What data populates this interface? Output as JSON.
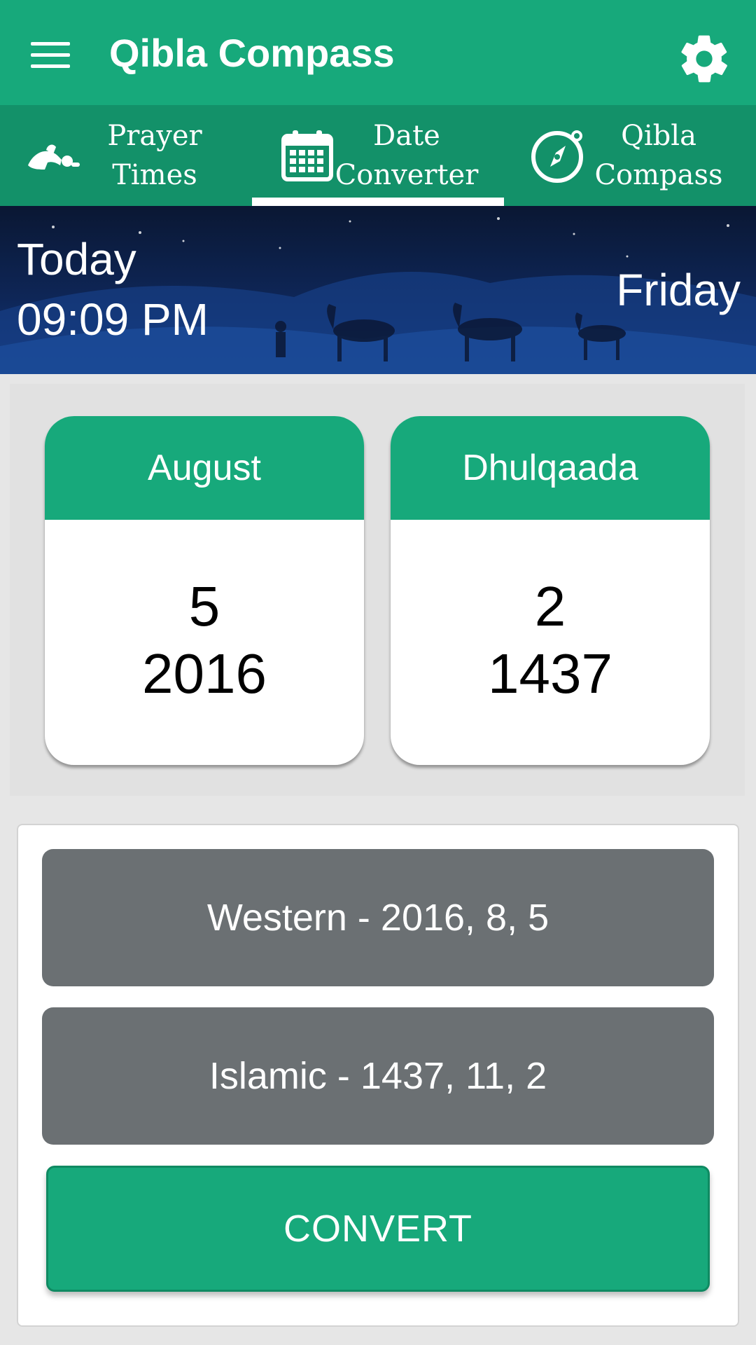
{
  "appbar": {
    "title": "Qibla Compass",
    "menu_icon": "hamburger-icon",
    "settings_icon": "gear-icon"
  },
  "tabs": [
    {
      "label_line1": "Prayer",
      "label_line2": "Times",
      "icon": "prayer-icon",
      "selected": false
    },
    {
      "label_line1": "Date",
      "label_line2": "Converter",
      "icon": "calendar-icon",
      "selected": true
    },
    {
      "label_line1": "Qibla",
      "label_line2": "Compass",
      "icon": "compass-icon",
      "selected": false
    }
  ],
  "header": {
    "today_label": "Today",
    "time": "09:09 PM",
    "weekday": "Friday"
  },
  "gregorian_card": {
    "month": "August",
    "day": "5",
    "year": "2016"
  },
  "hijri_card": {
    "month": "Dhulqaada",
    "day": "2",
    "year": "1437"
  },
  "results": {
    "western": "Western - 2016, 8, 5",
    "islamic": "Islamic - 1437, 11, 2"
  },
  "convert_button": {
    "label": "CONVERT"
  },
  "colors": {
    "primary": "#17a97b",
    "tab_bar": "#139169",
    "result_bg": "#6b7073",
    "night_sky": "#0e2657"
  }
}
